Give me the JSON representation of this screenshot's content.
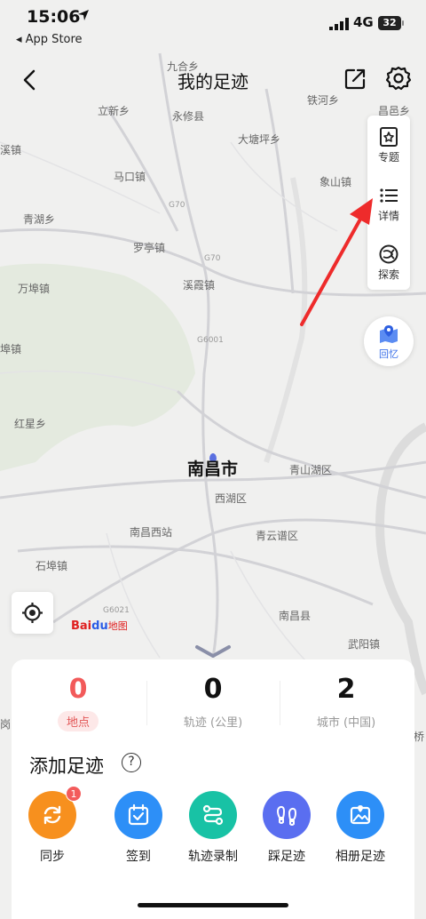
{
  "status_bar": {
    "time": "15:06",
    "back_app": "◂ App Store",
    "network": "4G",
    "battery": "32"
  },
  "nav": {
    "title": "我的足迹"
  },
  "map": {
    "city": "南昌市",
    "places": {
      "yongxiu": "永修县",
      "lixin": "立新乡",
      "tiehe": "铁河乡",
      "dataoping": "大塘坪乡",
      "malukou": "马口镇",
      "xiangshan": "象山镇",
      "qinghu": "青湖乡",
      "luoting": "罗亭镇",
      "wanbu": "万埠镇",
      "xixia": "溪霞镇",
      "hongxing": "红星乡",
      "qingshanhu": "青山湖区",
      "xihu": "西湖区",
      "nanchangxi": "南昌西站",
      "qingyunpu": "青云谱区",
      "shibu": "石埠镇",
      "nanchangxian": "南昌县",
      "wuyang": "武阳镇",
      "changyi": "昌邑乡",
      "xichuan": "溪镇",
      "jiu": "九合乡",
      "qiao": "桥",
      "bu": "埠镇",
      "gang": "岗"
    },
    "roads": [
      "G70",
      "G70",
      "G6001",
      "G6021"
    ],
    "baidu_logo": {
      "bai": "Bai",
      "paw": "du",
      "ditu": "地图"
    }
  },
  "side_menu": [
    {
      "label": "专题",
      "icon": "star-bookmark-icon"
    },
    {
      "label": "详情",
      "icon": "list-icon"
    },
    {
      "label": "探索",
      "icon": "explore-icon"
    }
  ],
  "memory_button": {
    "label": "回忆",
    "icon": "map-pin-icon"
  },
  "stats": [
    {
      "value": "0",
      "caption": "地点"
    },
    {
      "value": "0",
      "caption": "轨迹 (公里)"
    },
    {
      "value": "2",
      "caption": "城市 (中国)"
    }
  ],
  "add_section": {
    "title": "添加足迹",
    "help": "?"
  },
  "actions": [
    {
      "label": "同步",
      "color": "#f7901e",
      "icon": "sync-icon",
      "badge": "1"
    },
    {
      "label": "签到",
      "color": "#2d8ff7",
      "icon": "checkin-icon"
    },
    {
      "label": "轨迹录制",
      "color": "#18c2a5",
      "icon": "track-record-icon"
    },
    {
      "label": "踩足迹",
      "color": "#5a6ef0",
      "icon": "footprint-icon"
    },
    {
      "label": "相册足迹",
      "color": "#2d8ff7",
      "icon": "album-icon"
    }
  ],
  "colors": {
    "accent_red": "#f25a5a",
    "annotation_arrow": "#ee2b2b"
  }
}
